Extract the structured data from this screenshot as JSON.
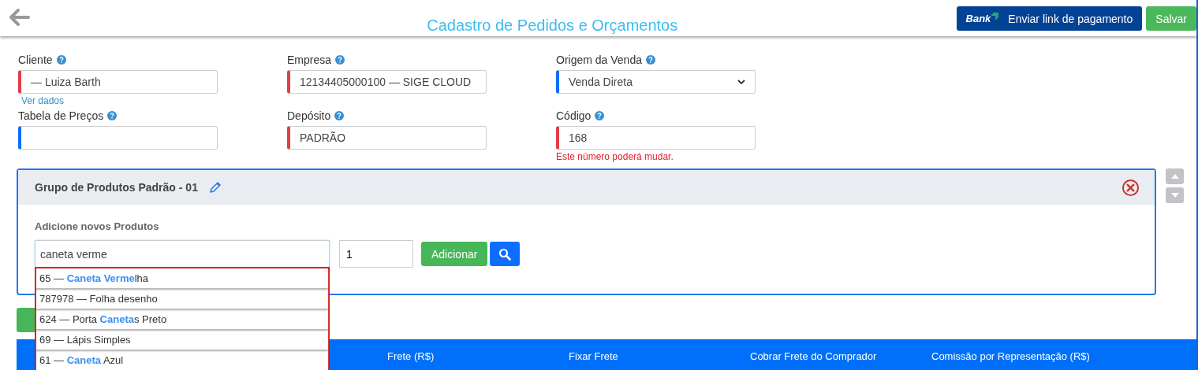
{
  "header": {
    "title": "Cadastro de Pedidos e Orçamentos",
    "bank_logo": "Bank",
    "buttons": [
      {
        "label": "Enviar link de pagamento",
        "kind": "bank"
      },
      {
        "label": "Salvar",
        "kind": "save"
      }
    ]
  },
  "form": {
    "fields": [
      {
        "label": "Cliente",
        "value": "— Luiza Barth",
        "kind": "text",
        "required": true,
        "link": "Ver dados"
      },
      {
        "label": "Empresa",
        "value": "12134405000100 — SIGE CLOUD",
        "kind": "text",
        "required": true
      },
      {
        "label": "Origem da Venda",
        "value": "Venda Direta",
        "kind": "select",
        "required": false
      },
      {
        "label": "Tabela de Preços",
        "kind": "text",
        "required": false
      },
      {
        "label": "Depósito",
        "value": "PADRÃO",
        "kind": "text",
        "required": true
      },
      {
        "label": "Código",
        "value": "168",
        "kind": "text",
        "required": true,
        "error": "Este número poderá mudar."
      }
    ]
  },
  "product_group": {
    "title": "Grupo de Produtos Padrão - 01",
    "add_label": "Adicione novos Produtos",
    "search_value": "caneta verme",
    "quantity": "1",
    "add_button": "Adicionar",
    "suggestions": [
      "65 — **Caneta Verme**lha",
      "787978 — Folha desenho",
      "624 — Porta **Caneta**s Preto",
      "69 — Lápis Simples",
      "61 — **Caneta** Azul"
    ]
  },
  "summary_bar": {
    "columns": [
      "Frete (R$)",
      "Fixar Frete",
      "Cobrar Frete do Comprador",
      "Comissão por Representação (R$)"
    ]
  }
}
